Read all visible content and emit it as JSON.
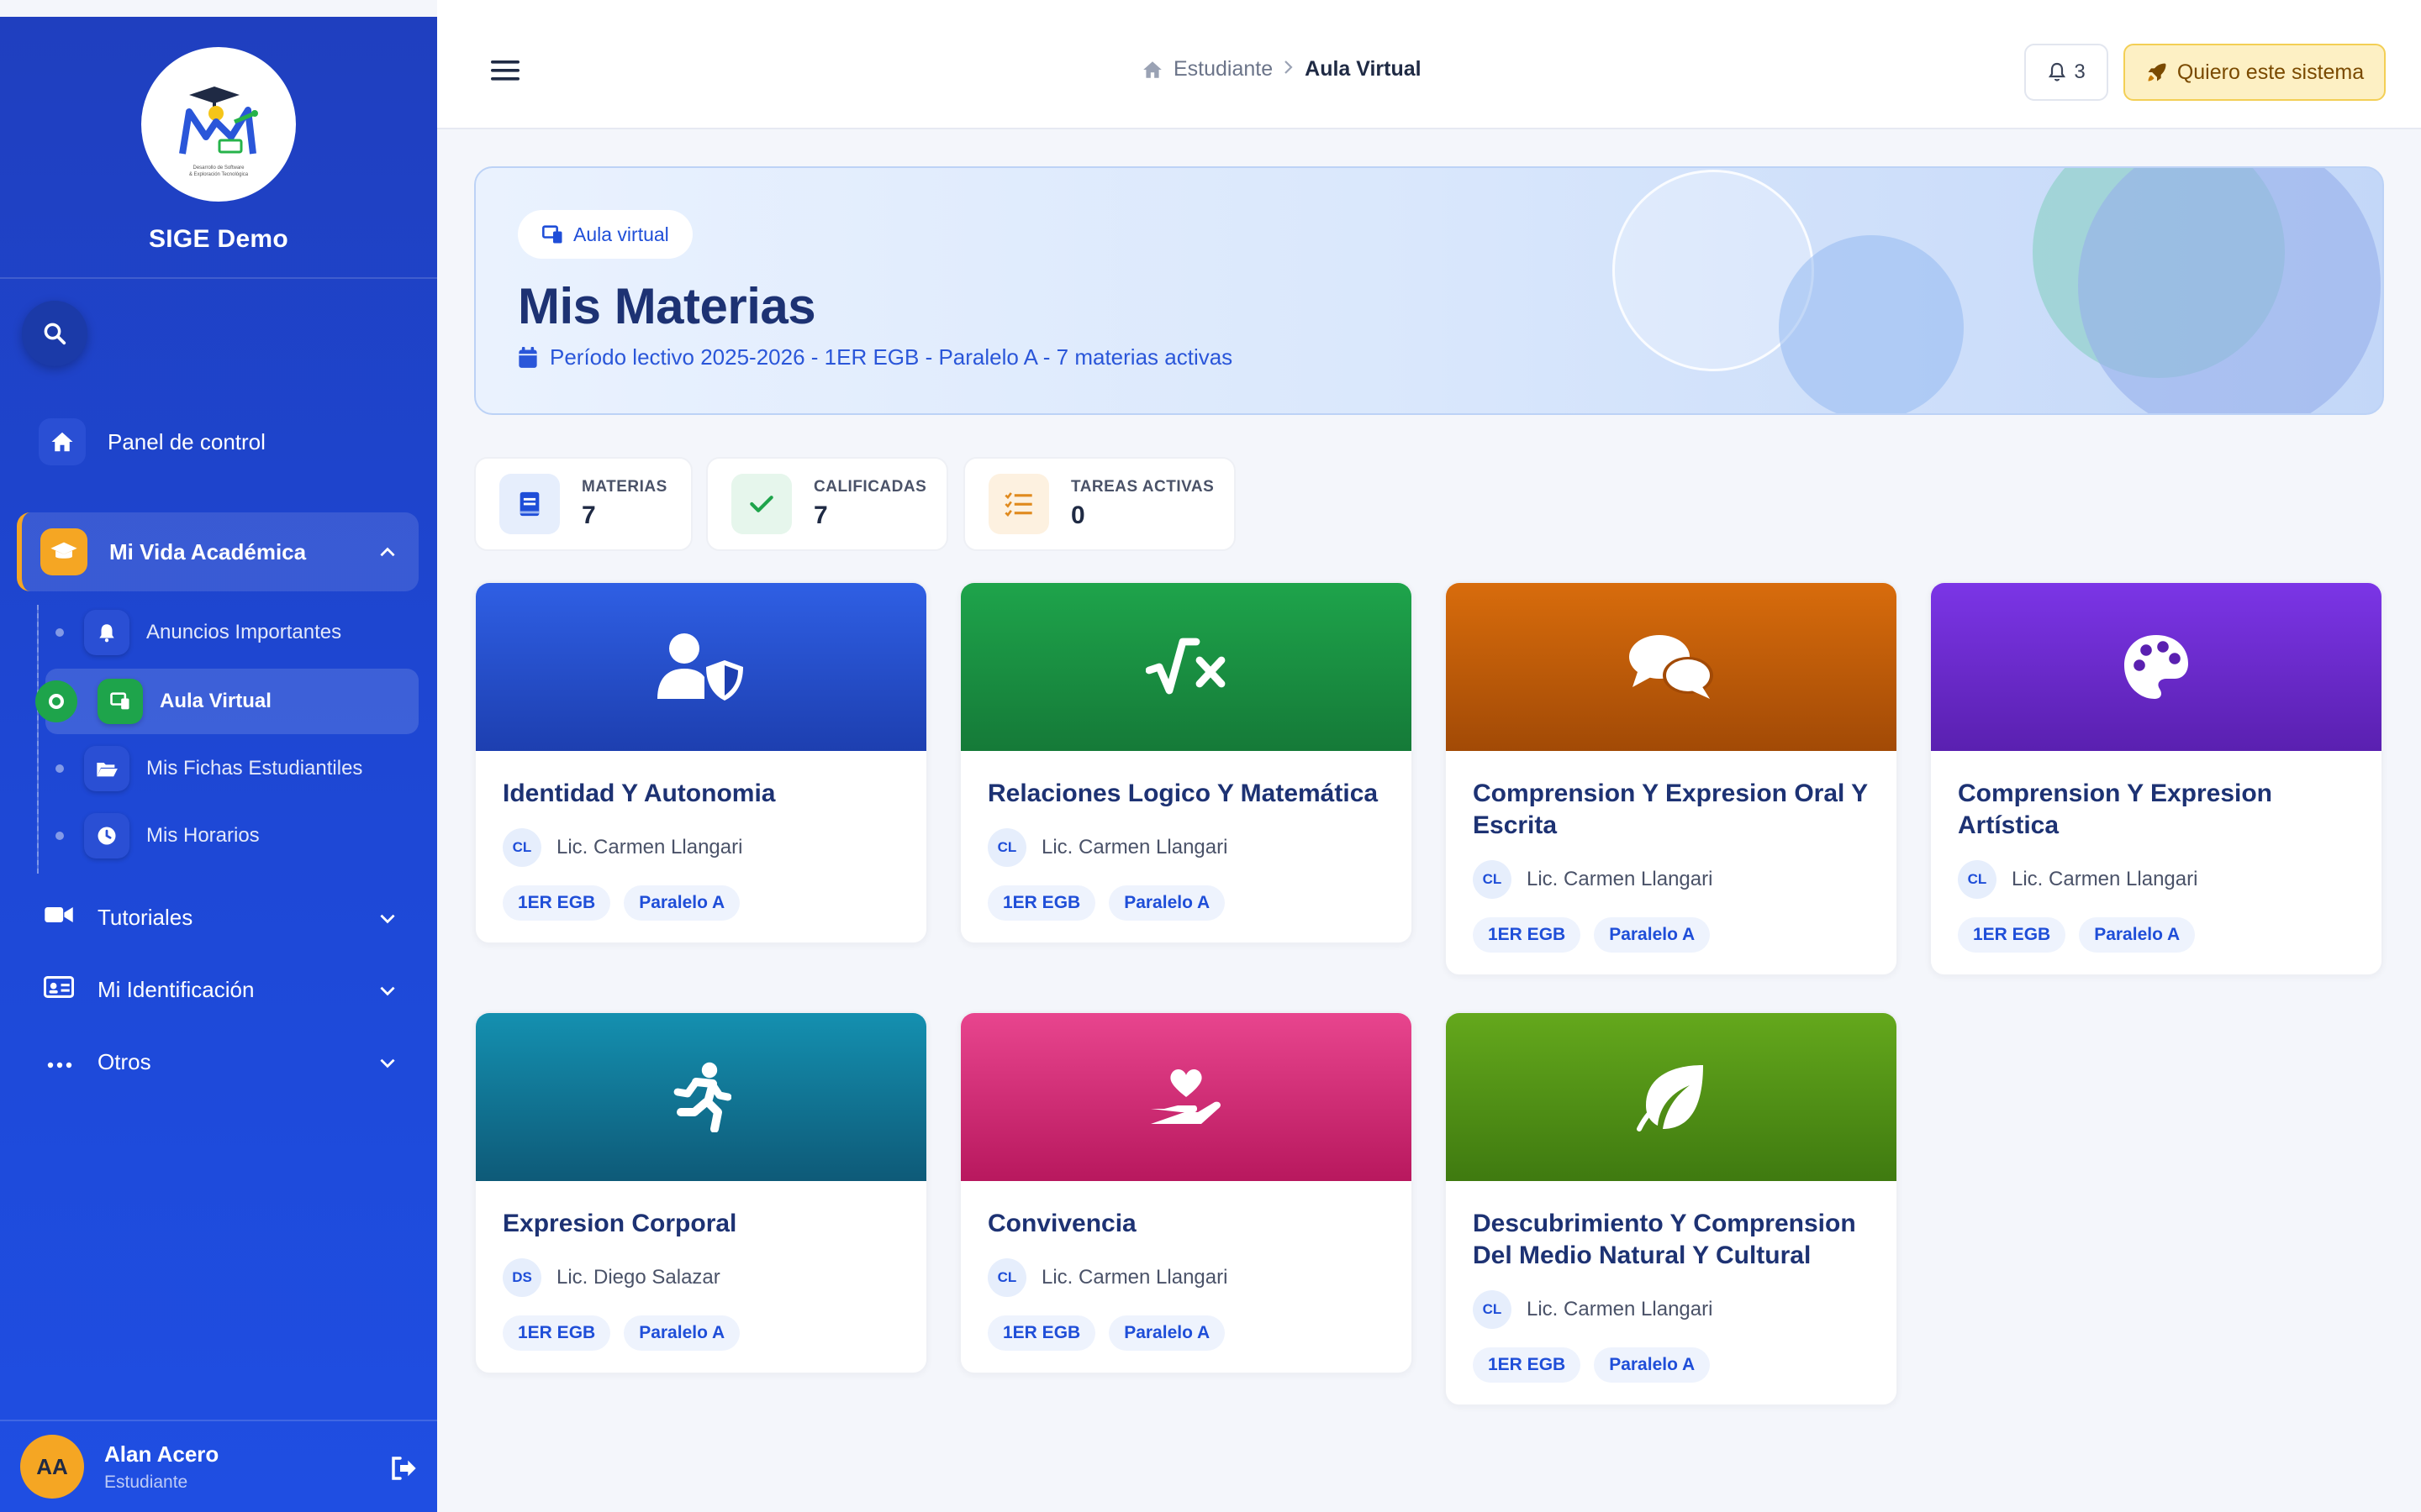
{
  "sidebar": {
    "brand_name": "SIGE Demo",
    "logo_caption_1": "Desarrollo de Software",
    "logo_caption_2": "& Exploración Tecnológica",
    "nav": {
      "panel": "Panel de control",
      "academic": "Mi Vida Académica",
      "tutorials": "Tutoriales",
      "identification": "Mi Identificación",
      "others": "Otros"
    },
    "subitems": {
      "announcements": "Anuncios Importantes",
      "virtual_classroom": "Aula Virtual",
      "student_records": "Mis Fichas Estudiantiles",
      "schedules": "Mis Horarios"
    },
    "user": {
      "initials": "AA",
      "name": "Alan Acero",
      "role": "Estudiante"
    }
  },
  "topbar": {
    "breadcrumb_home": "Estudiante",
    "breadcrumb_current": "Aula Virtual",
    "notification_count": "3",
    "cta_label": "Quiero este sistema"
  },
  "hero": {
    "badge": "Aula virtual",
    "title": "Mis Materias",
    "subtitle": "Período lectivo 2025-2026 - 1ER EGB - Paralelo A - 7 materias activas"
  },
  "stats": {
    "subjects": {
      "label": "MATERIAS",
      "value": "7"
    },
    "graded": {
      "label": "CALIFICADAS",
      "value": "7"
    },
    "tasks": {
      "label": "TAREAS ACTIVAS",
      "value": "0"
    }
  },
  "courses": [
    {
      "title": "Identidad Y Autonomia",
      "initials": "CL",
      "teacher": "Lic. Carmen Llangari",
      "grade": "1ER EGB",
      "section": "Paralelo A",
      "icon": "user-shield-icon",
      "color_from": "#2f5fe4",
      "color_to": "#1d3fb0"
    },
    {
      "title": "Relaciones Logico Y Matemática",
      "initials": "CL",
      "teacher": "Lic. Carmen Llangari",
      "grade": "1ER EGB",
      "section": "Paralelo A",
      "icon": "square-root-icon",
      "color_from": "#1ea44b",
      "color_to": "#157a38"
    },
    {
      "title": "Comprension Y Expresion Oral Y Escrita",
      "initials": "CL",
      "teacher": "Lic. Carmen Llangari",
      "grade": "1ER EGB",
      "section": "Paralelo A",
      "icon": "comments-icon",
      "color_from": "#d86c0c",
      "color_to": "#a24a06"
    },
    {
      "title": "Comprension Y Expresion Artística",
      "initials": "CL",
      "teacher": "Lic. Carmen Llangari",
      "grade": "1ER EGB",
      "section": "Paralelo A",
      "icon": "palette-icon",
      "color_from": "#7b35e6",
      "color_to": "#5a20b0"
    },
    {
      "title": "Expresion Corporal",
      "initials": "DS",
      "teacher": "Lic. Diego Salazar",
      "grade": "1ER EGB",
      "section": "Paralelo A",
      "icon": "running-icon",
      "color_from": "#1490b0",
      "color_to": "#0e5a78"
    },
    {
      "title": "Convivencia",
      "initials": "CL",
      "teacher": "Lic. Carmen Llangari",
      "grade": "1ER EGB",
      "section": "Paralelo A",
      "icon": "hand-heart-icon",
      "color_from": "#e8458e",
      "color_to": "#b8185e"
    },
    {
      "title": "Descubrimiento Y Comprension Del Medio Natural Y Cultural",
      "initials": "CL",
      "teacher": "Lic. Carmen Llangari",
      "grade": "1ER EGB",
      "section": "Paralelo A",
      "icon": "leaf-icon",
      "color_from": "#64a81c",
      "color_to": "#3f7a10"
    }
  ]
}
